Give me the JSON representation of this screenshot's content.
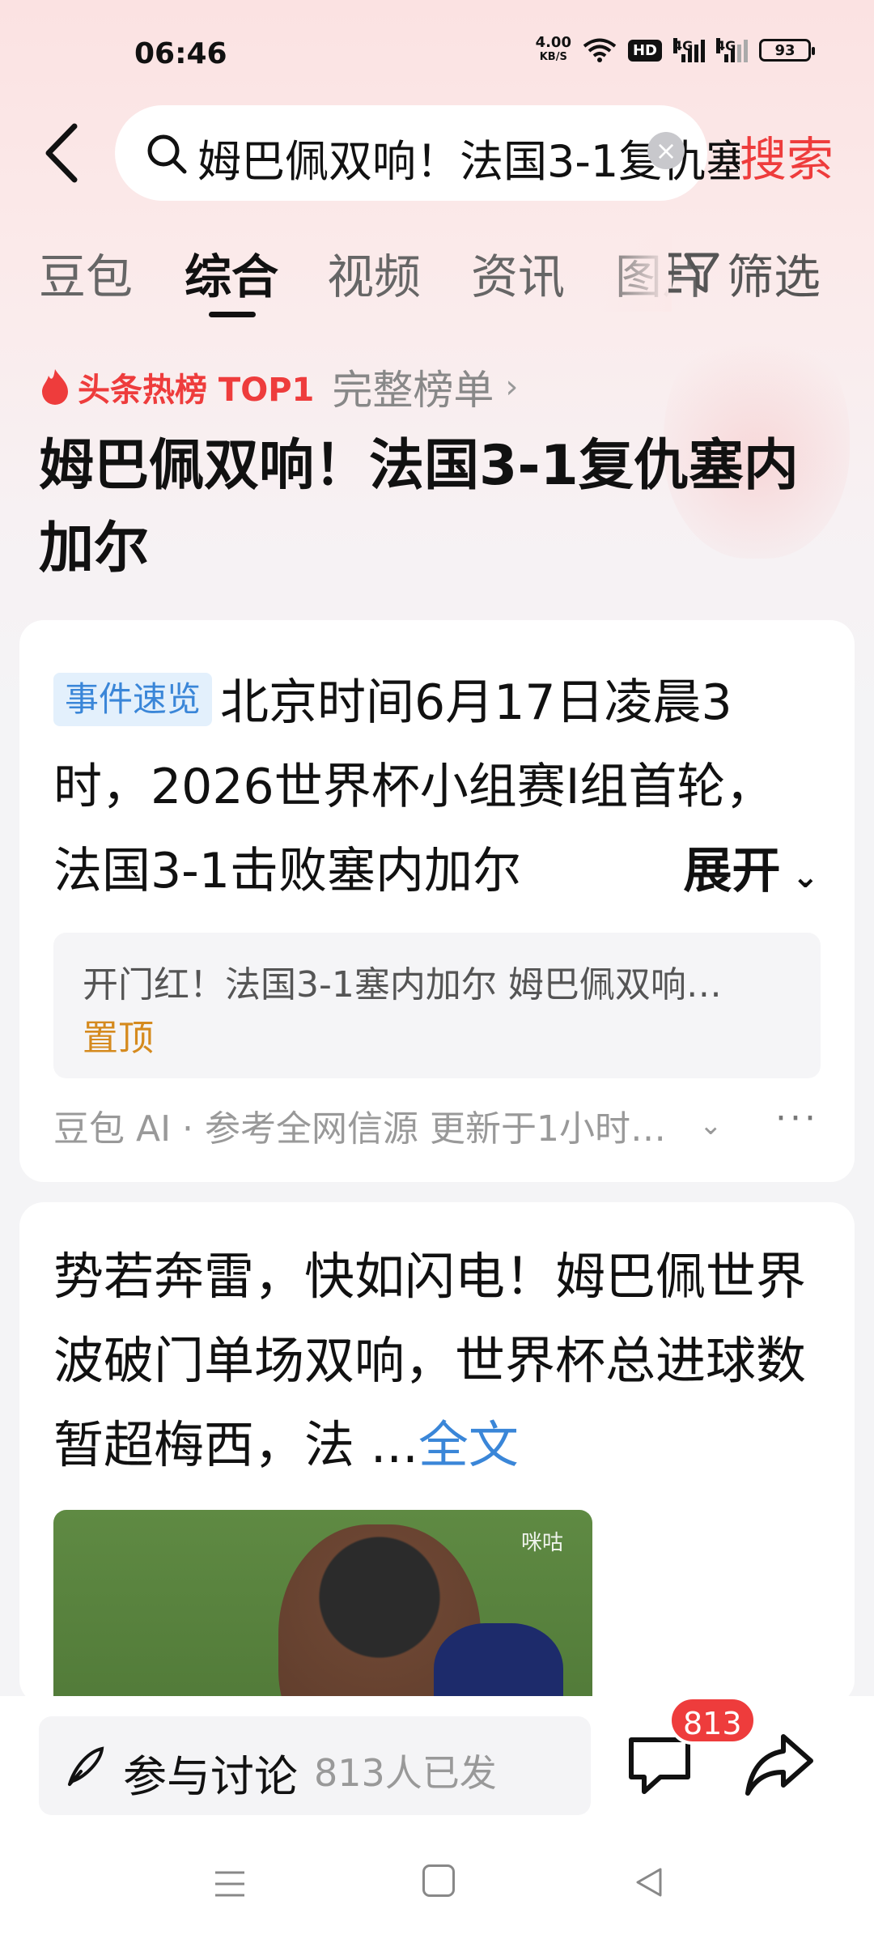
{
  "status_bar": {
    "time": "06:46",
    "net_speed_value": "4.00",
    "net_speed_unit": "KB/S",
    "hd_label": "HD",
    "signal1_label": "4G",
    "signal2_label": "4G",
    "battery": "93"
  },
  "search": {
    "query": "姆巴佩双响！法国3-1复仇塞内加尔",
    "submit_label": "搜索"
  },
  "tabs": [
    {
      "label": "豆包",
      "active": false
    },
    {
      "label": "综合",
      "active": true
    },
    {
      "label": "视频",
      "active": false
    },
    {
      "label": "资讯",
      "active": false
    },
    {
      "label": "图片",
      "active": false
    }
  ],
  "filter_label": "筛选",
  "hot": {
    "label": "头条热榜 TOP1",
    "full_list_label": "完整榜单"
  },
  "headline": "姆巴佩双响！法国3-1复仇塞内加尔",
  "summary_card": {
    "tag": "事件速览",
    "text": "北京时间6月17日凌晨3时，2026世界杯小组赛I组首轮，法国3-1击败塞内加尔",
    "expand_label": "展开",
    "ref_title": "开门红！法国3-1塞内加尔 姆巴佩双响…",
    "ref_pin": "置顶",
    "footer": "豆包 AI · 参考全网信源 更新于1小时…"
  },
  "article_card": {
    "text": "势若奔雷，快如闪电！姆巴佩世界波破门单场双响，世界杯总进球数暂超梅西，法 ...",
    "fulltext_label": "全文",
    "image_watermark": "咪咕"
  },
  "bottom_bar": {
    "discuss_label": "参与讨论",
    "discuss_count": "813人已发",
    "comment_badge": "813"
  },
  "colors": {
    "accent_red": "#ee3c3c",
    "link_blue": "#3a86d8",
    "pin_orange": "#d58a1e",
    "tag_bg": "#e3f0fc"
  }
}
